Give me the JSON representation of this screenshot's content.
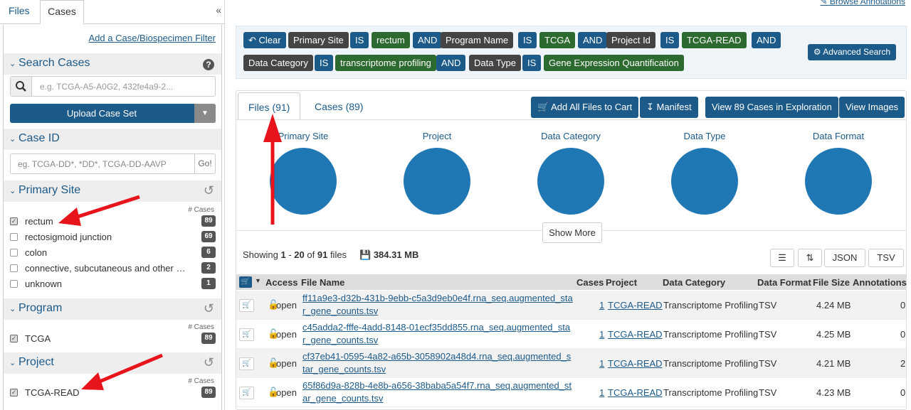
{
  "sidebar": {
    "tabs": [
      "Files",
      "Cases"
    ],
    "collapse_icon": "«",
    "add_filter": "Add a Case/Biospecimen Filter",
    "search_cases_title": "Search Cases",
    "search_placeholder": "e.g. TCGA-A5-A0G2, 432fe4a9-2...",
    "upload_label": "Upload Case Set",
    "case_id_title": "Case ID",
    "case_id_placeholder": "eg. TCGA-DD*, *DD*, TCGA-DD-AAVP",
    "go_label": "Go!",
    "count_header": "# Cases",
    "primary_site": {
      "title": "Primary Site",
      "items": [
        {
          "name": "rectum",
          "count": "89",
          "checked": true
        },
        {
          "name": "rectosigmoid junction",
          "count": "69",
          "checked": false
        },
        {
          "name": "colon",
          "count": "6",
          "checked": false
        },
        {
          "name": "connective, subcutaneous and other soft tissues",
          "count": "2",
          "checked": false
        },
        {
          "name": "unknown",
          "count": "1",
          "checked": false
        }
      ]
    },
    "program": {
      "title": "Program",
      "items": [
        {
          "name": "TCGA",
          "count": "89",
          "checked": true
        }
      ]
    },
    "project": {
      "title": "Project",
      "items": [
        {
          "name": "TCGA-READ",
          "count": "89",
          "checked": true
        }
      ]
    }
  },
  "main": {
    "browse_annotations": "Browse Annotations",
    "query": {
      "clear": "Clear",
      "pills": [
        {
          "text": "Primary Site",
          "kind": "dark"
        },
        {
          "text": "IS",
          "kind": "blue"
        },
        {
          "text": "rectum",
          "kind": "green"
        },
        {
          "text": "AND",
          "kind": "blue"
        },
        {
          "text": "Program Name",
          "kind": "dark"
        },
        {
          "text": "IS",
          "kind": "blue"
        },
        {
          "text": "TCGA",
          "kind": "green"
        },
        {
          "text": "AND",
          "kind": "blue"
        },
        {
          "text": "Project Id",
          "kind": "dark"
        },
        {
          "text": "IS",
          "kind": "blue"
        },
        {
          "text": "TCGA-READ",
          "kind": "green"
        },
        {
          "text": "AND",
          "kind": "blue"
        },
        {
          "text": "Data Category",
          "kind": "dark"
        },
        {
          "text": "IS",
          "kind": "blue"
        },
        {
          "text": "transcriptome profiling",
          "kind": "green"
        },
        {
          "text": "AND",
          "kind": "blue"
        },
        {
          "text": "Data Type",
          "kind": "dark"
        },
        {
          "text": "IS",
          "kind": "blue"
        },
        {
          "text": "Gene Expression Quantification",
          "kind": "green"
        }
      ],
      "advanced_search": "Advanced Search"
    },
    "tabs": {
      "files": "Files (91)",
      "cases": "Cases (89)"
    },
    "actions": {
      "add_all": "Add All Files to Cart",
      "manifest": "Manifest",
      "view_cases": "View 89 Cases in Exploration",
      "view_images": "View Images"
    },
    "charts": [
      "Primary Site",
      "Project",
      "Data Category",
      "Data Type",
      "Data Format"
    ],
    "show_more": "Show More",
    "showing": {
      "prefix": "Showing",
      "from": "1",
      "to": "20",
      "total": "91",
      "suffix": "files",
      "size": "384.31 MB"
    },
    "toolbar": {
      "json": "JSON",
      "tsv": "TSV"
    },
    "columns": [
      "Access",
      "File Name",
      "Cases",
      "Project",
      "Data Category",
      "Data Format",
      "File Size",
      "Annotations"
    ],
    "rows": [
      {
        "access": "open",
        "file": "ff11a9e3-d32b-431b-9ebb-c5a3d9eb0e4f.rna_seq.augmented_star_gene_counts.tsv",
        "cases": "1",
        "project": "TCGA-READ",
        "category": "Transcriptome Profiling",
        "format": "TSV",
        "size": "4.24 MB",
        "annotations": "0"
      },
      {
        "access": "open",
        "file": "c45adda2-fffe-4add-8148-01ecf35dd855.rna_seq.augmented_star_gene_counts.tsv",
        "cases": "1",
        "project": "TCGA-READ",
        "category": "Transcriptome Profiling",
        "format": "TSV",
        "size": "4.25 MB",
        "annotations": "0"
      },
      {
        "access": "open",
        "file": "cf37eb41-0595-4a82-a65b-3058902a48d4.rna_seq.augmented_star_gene_counts.tsv",
        "cases": "1",
        "project": "TCGA-READ",
        "category": "Transcriptome Profiling",
        "format": "TSV",
        "size": "4.21 MB",
        "annotations": "2"
      },
      {
        "access": "open",
        "file": "65f86d9a-828b-4e8b-a656-38baba5a54f7.rna_seq.augmented_star_gene_counts.tsv",
        "cases": "1",
        "project": "TCGA-READ",
        "category": "Transcriptome Profiling",
        "format": "TSV",
        "size": "4.23 MB",
        "annotations": "0"
      }
    ]
  },
  "colors": {
    "primary": "#1c5a8a",
    "filter_value": "#2c6a2f",
    "filter_field": "#444444",
    "chart": "#1f78b4",
    "arrow": "#e8141c"
  }
}
